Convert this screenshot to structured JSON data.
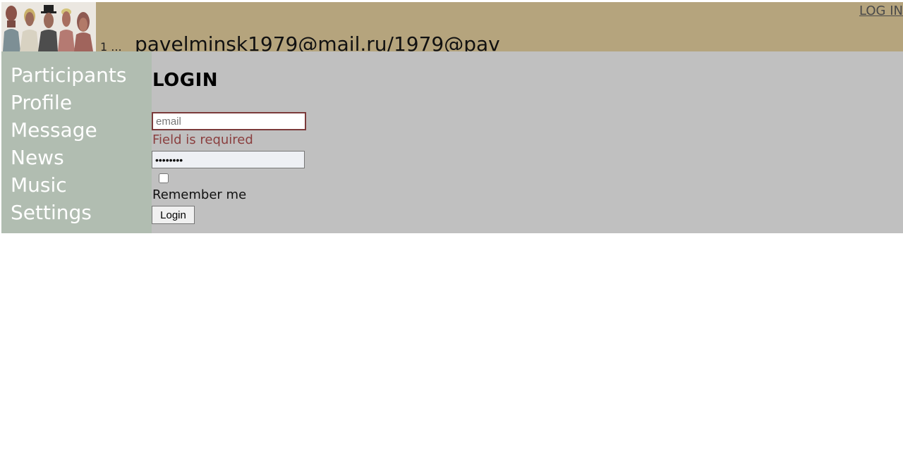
{
  "header": {
    "user_number": "1 ...",
    "user_email": "pavelminsk1979@mail.ru/1979@pav",
    "login_link": "LOG IN"
  },
  "sidebar": {
    "items": [
      {
        "label": "Participants"
      },
      {
        "label": "Profile"
      },
      {
        "label": "Message"
      },
      {
        "label": "News"
      },
      {
        "label": "Music"
      },
      {
        "label": "Settings"
      }
    ]
  },
  "login_form": {
    "title": "LOGIN",
    "email_placeholder": "email",
    "email_value": "",
    "email_error": "Field is required",
    "password_value": "password",
    "remember_label": "Remember me",
    "remember_checked": false,
    "submit_label": "Login"
  },
  "colors": {
    "header_bg": "#b5a47d",
    "sidebar_bg": "#b1bdb1",
    "content_bg": "#c0c0c0",
    "error": "#8a3f3f"
  }
}
